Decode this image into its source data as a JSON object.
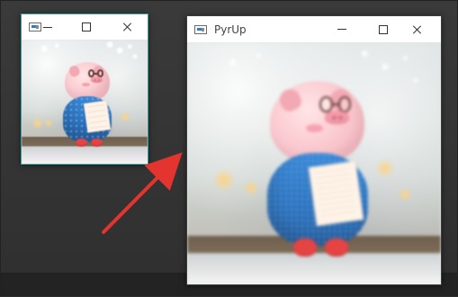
{
  "windows": {
    "small": {
      "title": "",
      "controls": {
        "minimize_icon": "minimize-icon",
        "maximize_icon": "maximize-icon",
        "close_icon": "close-icon"
      },
      "image": {
        "subject_icon": "pig-figure-image"
      }
    },
    "big": {
      "title": "PyrUp",
      "controls": {
        "minimize_icon": "minimize-icon",
        "maximize_icon": "maximize-icon",
        "close_icon": "close-icon"
      },
      "image": {
        "subject_icon": "pig-figure-image"
      }
    }
  },
  "annotation": {
    "arrow_color": "#e3342f"
  }
}
